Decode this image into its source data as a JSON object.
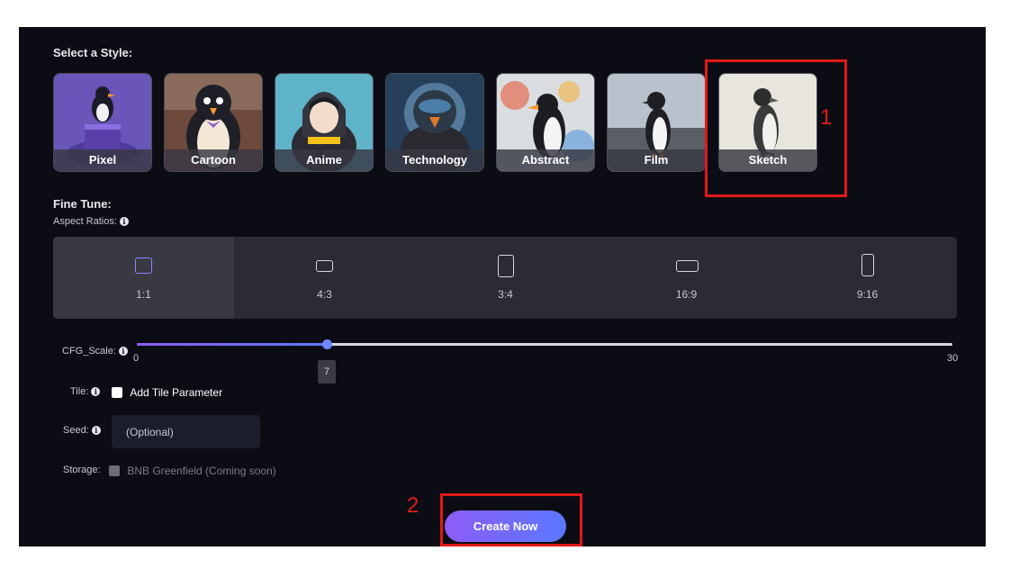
{
  "style_section": {
    "label": "Select a Style:",
    "styles": [
      {
        "label": "Pixel"
      },
      {
        "label": "Cartoon"
      },
      {
        "label": "Anime"
      },
      {
        "label": "Technology"
      },
      {
        "label": "Abstract"
      },
      {
        "label": "Film"
      },
      {
        "label": "Sketch"
      }
    ]
  },
  "fine_tune": {
    "label": "Fine Tune:",
    "aspect_label": "Aspect Ratios:",
    "ratios": [
      {
        "label": "1:1",
        "selected": true
      },
      {
        "label": "4:3",
        "selected": false
      },
      {
        "label": "3:4",
        "selected": false
      },
      {
        "label": "16:9",
        "selected": false
      },
      {
        "label": "9:16",
        "selected": false
      }
    ]
  },
  "cfg": {
    "label": "CFG_Scale:",
    "min": "0",
    "max": "30",
    "value": "7"
  },
  "tile": {
    "label": "Tile:",
    "option": "Add Tile Parameter",
    "checked": false
  },
  "seed": {
    "label": "Seed:",
    "placeholder": "(Optional)"
  },
  "storage": {
    "label": "Storage:",
    "option": "BNB Greenfield (Coming soon)"
  },
  "create_button": "Create Now",
  "annotations": {
    "one": "1",
    "two": "2"
  },
  "colors": {
    "panel_bg": "#0c0d14",
    "accent_start": "#8d5cf6",
    "accent_end": "#5a78ff",
    "annotation": "#e01919"
  }
}
